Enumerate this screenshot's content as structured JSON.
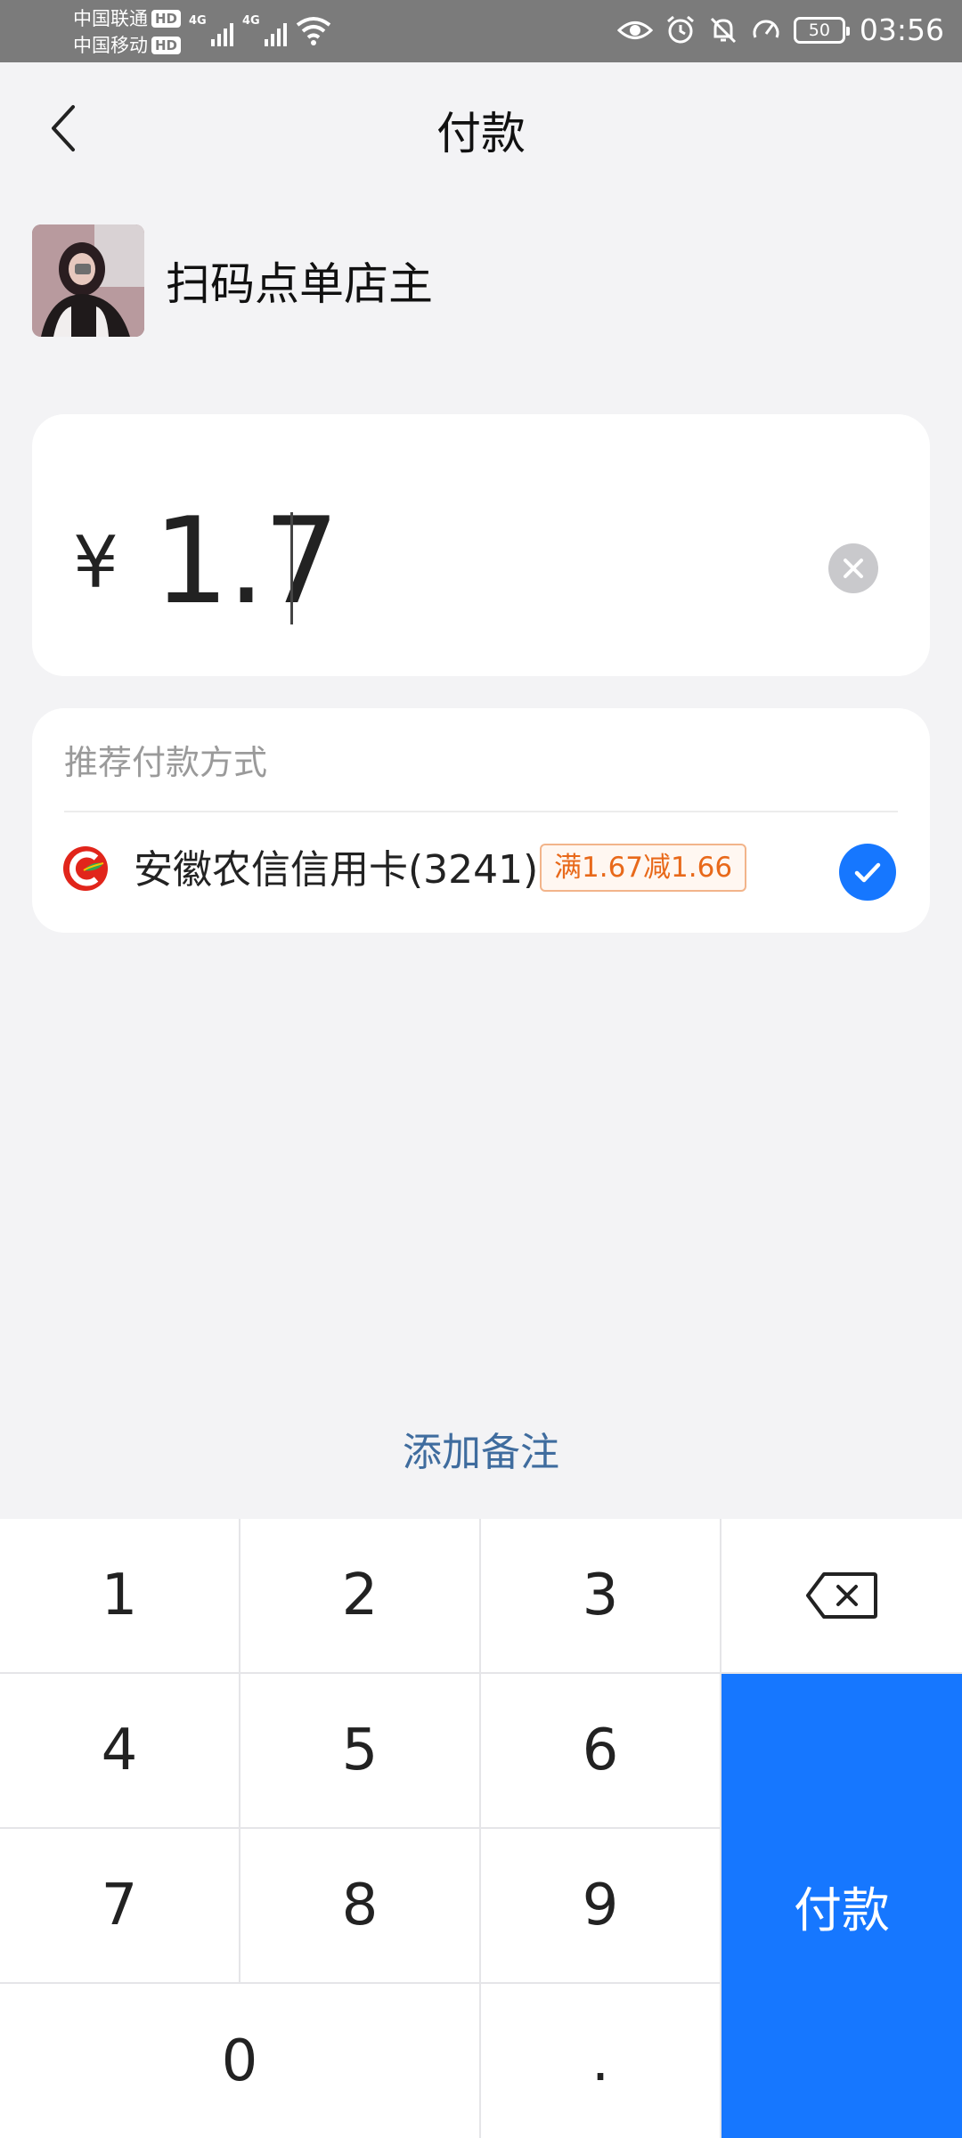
{
  "status_bar": {
    "carrier_1": "中国联通",
    "carrier_2": "中国移动",
    "hd_badge": "HD",
    "network_1": "4G",
    "network_2": "4G",
    "battery": "50",
    "time": "03:56"
  },
  "nav": {
    "title": "付款"
  },
  "merchant": {
    "name": "扫码点单店主"
  },
  "amount": {
    "currency": "¥",
    "value": "1.7"
  },
  "payment": {
    "section_title": "推荐付款方式",
    "method_name": "安徽农信信用卡(3241)",
    "promo": "满1.67减1.66",
    "selected": true
  },
  "add_note_label": "添加备注",
  "keypad": {
    "k1": "1",
    "k2": "2",
    "k3": "3",
    "k4": "4",
    "k5": "5",
    "k6": "6",
    "k7": "7",
    "k8": "8",
    "k9": "9",
    "k0": "0",
    "dot": ".",
    "pay_label": "付款"
  },
  "colors": {
    "accent": "#1677ff",
    "promo": "#e8691a",
    "link": "#3f6c9e"
  }
}
